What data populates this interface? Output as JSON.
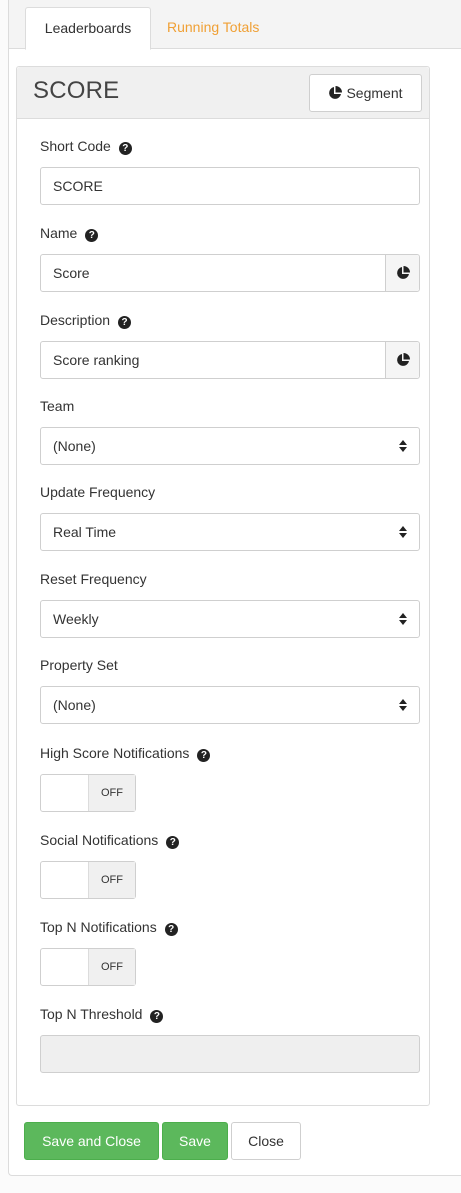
{
  "tabs": [
    {
      "label": "Leaderboards"
    },
    {
      "label": "Running Totals"
    }
  ],
  "panel": {
    "title": "SCORE",
    "segment_label": "Segment"
  },
  "fields": {
    "short_code": {
      "label": "Short Code",
      "value": "SCORE"
    },
    "name": {
      "label": "Name",
      "value": "Score"
    },
    "description": {
      "label": "Description",
      "value": "Score ranking"
    },
    "team": {
      "label": "Team",
      "value": "(None)"
    },
    "update_frequency": {
      "label": "Update Frequency",
      "value": "Real Time"
    },
    "reset_frequency": {
      "label": "Reset Frequency",
      "value": "Weekly"
    },
    "property_set": {
      "label": "Property Set",
      "value": "(None)"
    },
    "high_score_notifications": {
      "label": "High Score Notifications",
      "state": "OFF"
    },
    "social_notifications": {
      "label": "Social Notifications",
      "state": "OFF"
    },
    "top_n_notifications": {
      "label": "Top N Notifications",
      "state": "OFF"
    },
    "top_n_threshold": {
      "label": "Top N Threshold",
      "value": ""
    }
  },
  "help_glyph": "?",
  "buttons": {
    "save_and_close": "Save and Close",
    "save": "Save",
    "close": "Close"
  },
  "colors": {
    "accent_tab": "#f0a035",
    "success": "#5cb85c"
  }
}
